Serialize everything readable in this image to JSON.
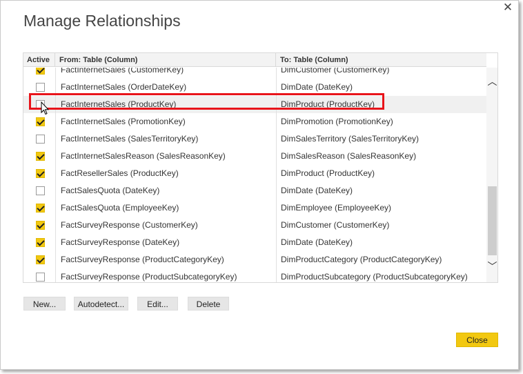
{
  "dialog": {
    "title": "Manage Relationships",
    "close_glyph": "✕"
  },
  "table": {
    "headers": {
      "active": "Active",
      "from": "From: Table (Column)",
      "to": "To: Table (Column)"
    },
    "rows": [
      {
        "active": true,
        "from": "FactInternetSales (CustomerKey)",
        "to": "DimCustomer (CustomerKey)"
      },
      {
        "active": false,
        "from": "FactInternetSales (OrderDateKey)",
        "to": "DimDate (DateKey)"
      },
      {
        "active": false,
        "from": "FactInternetSales (ProductKey)",
        "to": "DimProduct (ProductKey)"
      },
      {
        "active": true,
        "from": "FactInternetSales (PromotionKey)",
        "to": "DimPromotion (PromotionKey)"
      },
      {
        "active": false,
        "from": "FactInternetSales (SalesTerritoryKey)",
        "to": "DimSalesTerritory (SalesTerritoryKey)"
      },
      {
        "active": true,
        "from": "FactInternetSalesReason (SalesReasonKey)",
        "to": "DimSalesReason (SalesReasonKey)"
      },
      {
        "active": true,
        "from": "FactResellerSales (ProductKey)",
        "to": "DimProduct (ProductKey)"
      },
      {
        "active": false,
        "from": "FactSalesQuota (DateKey)",
        "to": "DimDate (DateKey)"
      },
      {
        "active": true,
        "from": "FactSalesQuota (EmployeeKey)",
        "to": "DimEmployee (EmployeeKey)"
      },
      {
        "active": true,
        "from": "FactSurveyResponse (CustomerKey)",
        "to": "DimCustomer (CustomerKey)"
      },
      {
        "active": true,
        "from": "FactSurveyResponse (DateKey)",
        "to": "DimDate (DateKey)"
      },
      {
        "active": true,
        "from": "FactSurveyResponse (ProductCategoryKey)",
        "to": "DimProductCategory (ProductCategoryKey)"
      },
      {
        "active": false,
        "from": "FactSurveyResponse (ProductSubcategoryKey)",
        "to": "DimProductSubcategory (ProductSubcategoryKey)"
      }
    ],
    "highlighted_row_index": 2
  },
  "scrollbar": {
    "up_glyph": "︿",
    "down_glyph": "﹀"
  },
  "buttons": {
    "new": "New...",
    "autodetect": "Autodetect...",
    "edit": "Edit...",
    "delete": "Delete",
    "close": "Close"
  },
  "colors": {
    "accent": "#f2c811",
    "highlight_border": "#e8141a"
  },
  "icons": {
    "close": "close-icon",
    "checkbox_checked": "checkbox-checked-icon",
    "checkbox_unchecked": "checkbox-unchecked-icon",
    "cursor": "mouse-pointer-icon"
  }
}
